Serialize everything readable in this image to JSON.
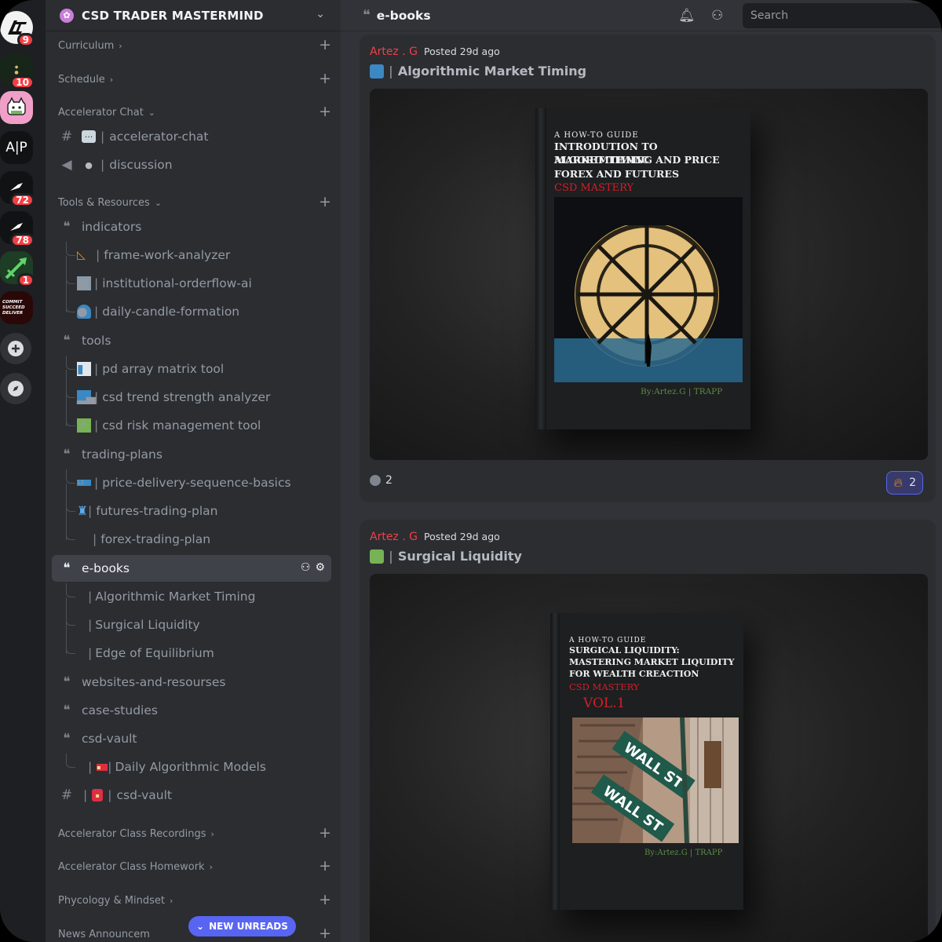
{
  "rail": {
    "servers": [
      {
        "name": "LT",
        "badge": "9",
        "color": "#f2f2f2"
      },
      {
        "name": "CROWN",
        "badge": "10",
        "color": "#1a2a1a"
      },
      {
        "name": "CAT",
        "badge": "",
        "color": "#f0a0c8"
      },
      {
        "name": "A|P",
        "badge": "",
        "color": "#111214"
      },
      {
        "name": "BIRD1",
        "badge": "72",
        "color": "#111214"
      },
      {
        "name": "BIRD2",
        "badge": "78",
        "color": "#111214"
      },
      {
        "name": "ROCKET",
        "badge": "1",
        "color": "#1d4d2a"
      },
      {
        "name": "COMMIT",
        "badge": "",
        "color": "#3a0b0b"
      }
    ],
    "ap_text": "A|P",
    "commit_text": "COMMIT SUCCEED DELIVER"
  },
  "guild": {
    "name": "CSD TRADER MASTERMIND"
  },
  "categories": {
    "curriculum": "Curriculum",
    "schedule": "Schedule",
    "accelerator_chat": "Accelerator Chat",
    "tools_resources": "Tools & Resources",
    "class_recordings": "Accelerator Class Recordings",
    "class_homework": "Accelerator Class Homework",
    "psychology": "Phycology & Mindset",
    "news": "News Announcem"
  },
  "channels": {
    "accelerator_chat": "accelerator-chat",
    "discussion": "discussion",
    "indicators": "indicators",
    "frame_work": "frame-work-analyzer",
    "institutional": "institutional-orderflow-ai",
    "daily_candle": "daily-candle-formation",
    "tools": "tools",
    "pd_array": "pd array matrix tool",
    "trend_strength": "csd trend strength analyzer",
    "risk_mgmt": "csd risk management tool",
    "trading_plans": "trading-plans",
    "price_delivery": "price-delivery-sequence-basics",
    "futures_plan": "futures-trading-plan",
    "forex_plan": "forex-trading-plan",
    "ebooks": "e-books",
    "algo_timing": "Algorithmic Market Timing",
    "surgical": "Surgical Liquidity",
    "edge": "Edge of Equilibrium",
    "websites": "websites-and-resourses",
    "case_studies": "case-studies",
    "csd_vault": "csd-vault",
    "daily_models": "Daily Algorithmic Models",
    "csd_vault_text": "csd-vault"
  },
  "new_unreads": "NEW UNREADS",
  "topbar": {
    "channel": "e-books",
    "search_placeholder": "Search"
  },
  "posts": [
    {
      "author": "Artez . G",
      "posted": "Posted 29d ago",
      "title": "Algorithmic Market Timing",
      "emoji_color": "#3b88c3",
      "book": {
        "kicker": "A HOW-TO GUIDE",
        "line1": "INTRODUTION TO ALGORIMTHMIC",
        "line2": "MARKET TIMING AND PRICE",
        "line3": "FOREX AND FUTURES",
        "brand": "CSD MASTERY",
        "byline": "By:Artez.G | TRAPP"
      },
      "comments": "2",
      "reaction_count": "2"
    },
    {
      "author": "Artez . G",
      "posted": "Posted 29d ago",
      "title": "Surgical Liquidity",
      "emoji_color": "#77b255",
      "book": {
        "kicker": "A HOW-TO GUIDE",
        "line1": "SURGICAL LIQUIDITY:",
        "line2": "MASTERING MARKET LIQUIDITY",
        "line3": "FOR WEALTH CREACTION",
        "brand": "CSD MASTERY",
        "volume": "VOL.1",
        "byline": "By:Artez.G | TRAPP",
        "sign1": "WALL ST",
        "sign2": "WALL ST"
      }
    }
  ]
}
